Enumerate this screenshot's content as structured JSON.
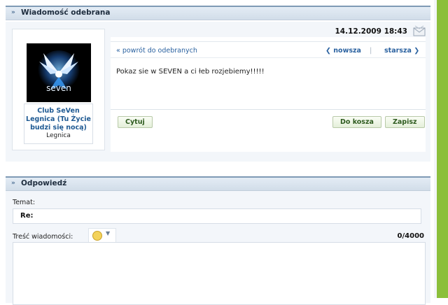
{
  "received_panel": {
    "title": "Wiadomość odebrana",
    "chevron": "»",
    "date": "14.12.2009 18:43",
    "envelope_icon": "envelope-icon"
  },
  "sender": {
    "name": "Club SeVen Legnica (Tu Życie budzi się nocą)",
    "city": "Legnica",
    "avatar_logo_text": "seven"
  },
  "message": {
    "back_link": "« powrót do odebranych",
    "prev_label": "nowsza",
    "next_label": "starsza",
    "separator": "|",
    "text": "Pokaz sie w SEVEN a ci łeb rozjebiemy!!!!!",
    "buttons": {
      "quote": "Cytuj",
      "trash": "Do kosza",
      "save": "Zapisz"
    }
  },
  "reply_panel": {
    "title": "Odpowiedź",
    "chevron": "»",
    "subject_label": "Temat:",
    "subject_value": "Re:",
    "body_label": "Treść wiadomości:",
    "counter": "0/4000",
    "emoticon_icon": "smiley-icon"
  },
  "colors": {
    "accent_green": "#8bbf3a",
    "link_blue": "#2b62a0",
    "header_border": "#7f9ab5"
  }
}
